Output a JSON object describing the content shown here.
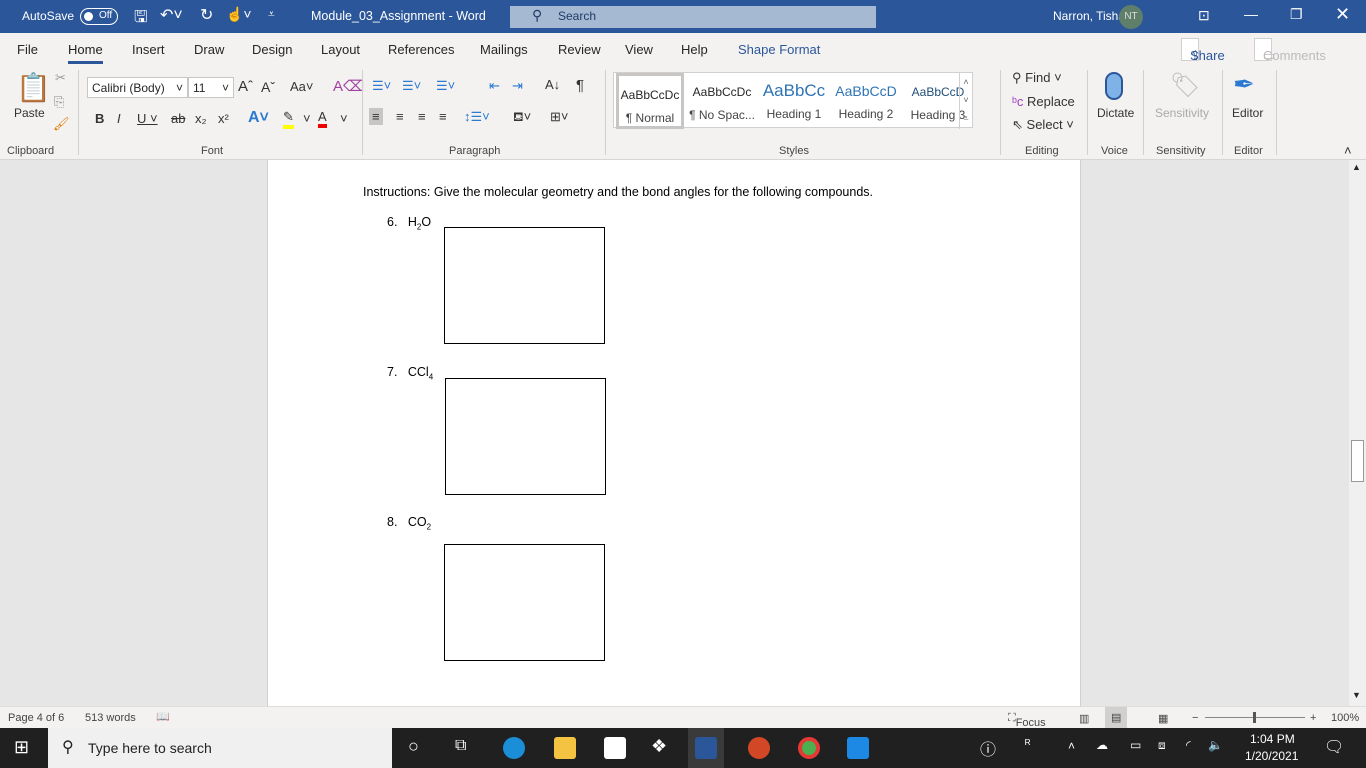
{
  "titlebar": {
    "autosave": "AutoSave",
    "autosave_state": "Off",
    "doc_title": "Module_03_Assignment  -  Word",
    "search": "Search",
    "user": "Narron, Tisha N",
    "initials": "NT"
  },
  "tabs": [
    "File",
    "Home",
    "Insert",
    "Draw",
    "Design",
    "Layout",
    "References",
    "Mailings",
    "Review",
    "View",
    "Help",
    "Shape Format"
  ],
  "share": "Share",
  "comments": "Comments",
  "ribbon": {
    "paste": "Paste",
    "font_name": "Calibri (Body)",
    "font_size": "11",
    "styles": [
      {
        "preview": "AaBbCcDc",
        "name": "¶ Normal"
      },
      {
        "preview": "AaBbCcDc",
        "name": "¶ No Spac..."
      },
      {
        "preview": "AaBbCc",
        "name": "Heading 1"
      },
      {
        "preview": "AaBbCcD",
        "name": "Heading 2"
      },
      {
        "preview": "AaBbCcD",
        "name": "Heading 3"
      }
    ],
    "find": "Find",
    "replace": "Replace",
    "select": "Select",
    "dictate": "Dictate",
    "sensitivity": "Sensitivity",
    "editor": "Editor",
    "groups": {
      "clipboard": "Clipboard",
      "font": "Font",
      "paragraph": "Paragraph",
      "styles": "Styles",
      "editing": "Editing",
      "voice": "Voice",
      "sensitivity": "Sensitivity",
      "editor": "Editor"
    }
  },
  "document": {
    "instructions": "Instructions: Give the molecular geometry and the bond angles for the following compounds.",
    "items": [
      {
        "num": "6.",
        "formula": "H",
        "sub": "2",
        "tail": "O"
      },
      {
        "num": "7.",
        "formula": "CCl",
        "sub": "4",
        "tail": ""
      },
      {
        "num": "8.",
        "formula": "CO",
        "sub": "2",
        "tail": ""
      }
    ]
  },
  "status": {
    "page": "Page 4 of 6",
    "words": "513 words",
    "focus": "Focus",
    "zoom": "100%"
  },
  "taskbar": {
    "search": "Type here to search",
    "time": "1:04 PM",
    "date": "1/20/2021"
  },
  "colors": {
    "brand": "#2b579a",
    "accent": "#2b579a"
  }
}
